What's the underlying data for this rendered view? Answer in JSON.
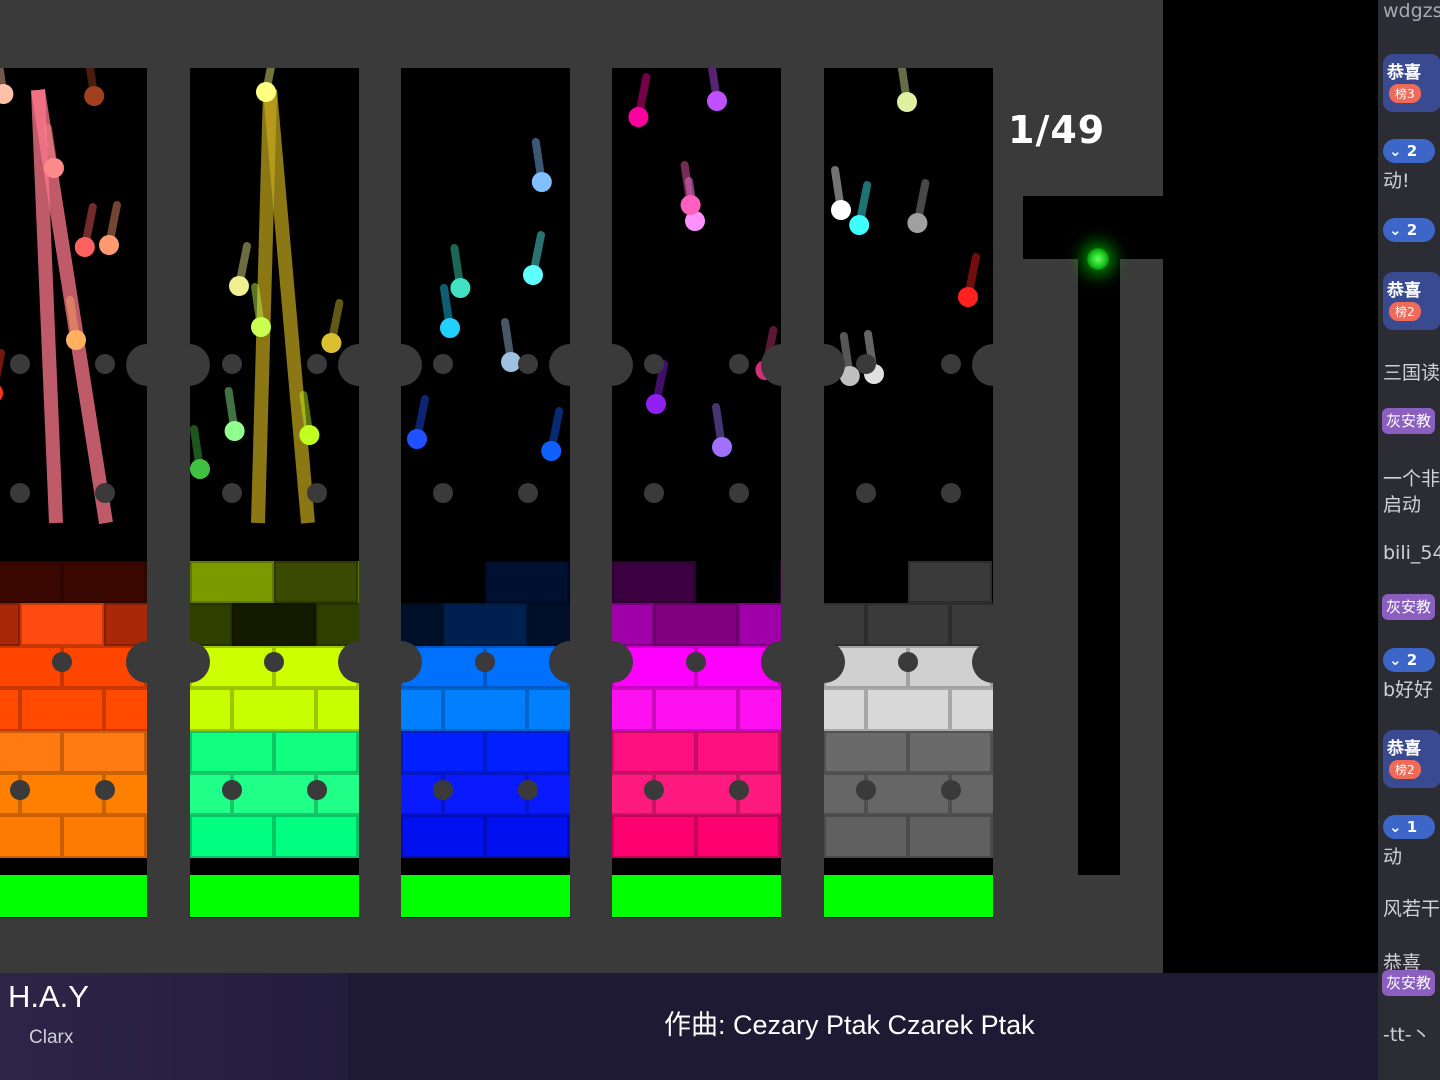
{
  "game": {
    "counter": "1/49",
    "columns": [
      {
        "name": "red",
        "accent": "#ff5a2a",
        "balls": [
          "#ff8a8a",
          "#ff9a70",
          "#ffc0a8",
          "#ff6060",
          "#a04020",
          "#ff3020",
          "#ffb060"
        ],
        "rows": [
          [
            "#3a0800",
            "#3a0800"
          ],
          [
            "#ff4a10",
            "#a82808"
          ],
          [
            "#ff4500",
            "#ff4500"
          ],
          [
            "#ff4a00",
            "#ff4a00"
          ],
          [
            "#ff7a10",
            "#ff7a10"
          ],
          [
            "#ff8000",
            "#ff8000"
          ],
          [
            "#ff7a00",
            "#ff7a00"
          ]
        ]
      },
      {
        "name": "yellow",
        "accent": "#d4ff00",
        "balls": [
          "#90ff90",
          "#d8c030",
          "#c8ff50",
          "#ffff80",
          "#40c040",
          "#f0f090",
          "#c0ff20"
        ],
        "rows": [
          [
            "#7a9a00",
            "#3a4a00"
          ],
          [
            "#141a00",
            "#2e4000"
          ],
          [
            "#ccff00",
            "#ccff00"
          ],
          [
            "#c8ff00",
            "#c8ff00"
          ],
          [
            "#10ff80",
            "#10ff80"
          ],
          [
            "#20ff88",
            "#20ff88"
          ],
          [
            "#00ff80",
            "#00ff80"
          ]
        ]
      },
      {
        "name": "blue",
        "accent": "#0080ff",
        "balls": [
          "#80c0ff",
          "#1060ff",
          "#20d0ff",
          "#60ffff",
          "#a0c0e0",
          "#2050ff",
          "#40e0c0"
        ],
        "rows": [
          [
            "#000",
            "#001030"
          ],
          [
            "#002050",
            "#001028"
          ],
          [
            "#0070ff",
            "#0070ff"
          ],
          [
            "#0080ff",
            "#0080ff"
          ],
          [
            "#0020ff",
            "#0020ff"
          ],
          [
            "#0a1aff",
            "#0a1aff"
          ],
          [
            "#0010ee",
            "#0010ee"
          ]
        ]
      },
      {
        "name": "magenta",
        "accent": "#ff00ff",
        "balls": [
          "#a070ff",
          "#9020f0",
          "#ff90ff",
          "#d0307a",
          "#ff60c0",
          "#ff00a0",
          "#c050ff"
        ],
        "rows": [
          [
            "#3a0040",
            "#000"
          ],
          [
            "#800080",
            "#a000a8"
          ],
          [
            "#ff00ff",
            "#ff00ff"
          ],
          [
            "#ff10f0",
            "#ff10f0"
          ],
          [
            "#ff1080",
            "#ff1080"
          ],
          [
            "#ff1a80",
            "#ff1a80"
          ],
          [
            "#ff0070",
            "#ff0070"
          ]
        ]
      },
      {
        "name": "gray",
        "accent": "#d0d0d0",
        "balls": [
          "#ffffff",
          "#ff2020",
          "#e0e0e0",
          "#a0a0a0",
          "#c0c0c0",
          "#40ffff",
          "#e0f0a0"
        ],
        "rows": [
          [
            "#000",
            "#3a3a3a"
          ],
          [
            "#3a3a3a",
            "#3a3a3a"
          ],
          [
            "#d0d0d0",
            "#d0d0d0"
          ],
          [
            "#d8d8d8",
            "#d8d8d8"
          ],
          [
            "#6a6a6a",
            "#6a6a6a"
          ],
          [
            "#666666",
            "#666666"
          ],
          [
            "#606060",
            "#606060"
          ]
        ]
      }
    ]
  },
  "colors": {
    "ground": "#00ff00",
    "board": "#3a3a3a",
    "tube_light": "#22cc22"
  },
  "chat": {
    "top_name": "wdgzs",
    "lines": [
      {
        "type": "gift",
        "text": "恭喜",
        "badge": "榜3"
      },
      {
        "type": "v",
        "text": "2"
      },
      {
        "type": "text",
        "text": "动!"
      },
      {
        "type": "v",
        "text": "2"
      },
      {
        "type": "gift",
        "text": "恭喜",
        "badge": "榜2"
      },
      {
        "type": "text",
        "text": "三国读"
      },
      {
        "type": "badge",
        "text": "灰安教"
      },
      {
        "type": "text",
        "text": "一个非"
      },
      {
        "type": "text",
        "text": "启动"
      },
      {
        "type": "text",
        "text": "bili_54"
      },
      {
        "type": "badge",
        "text": "灰安教"
      },
      {
        "type": "v",
        "text": "2"
      },
      {
        "type": "text",
        "text": "b好好"
      },
      {
        "type": "gift",
        "text": "恭喜",
        "badge": "榜2"
      },
      {
        "type": "v",
        "text": "1"
      },
      {
        "type": "text",
        "text": "动"
      },
      {
        "type": "text",
        "text": "风若干"
      },
      {
        "type": "text",
        "text": "恭喜"
      },
      {
        "type": "badge",
        "text": "灰安教"
      },
      {
        "type": "text",
        "text": "-tt-丶"
      }
    ]
  },
  "song": {
    "title": "H.A.Y",
    "artist": "Clarx",
    "composer": "作曲: Cezary Ptak Czarek Ptak"
  }
}
